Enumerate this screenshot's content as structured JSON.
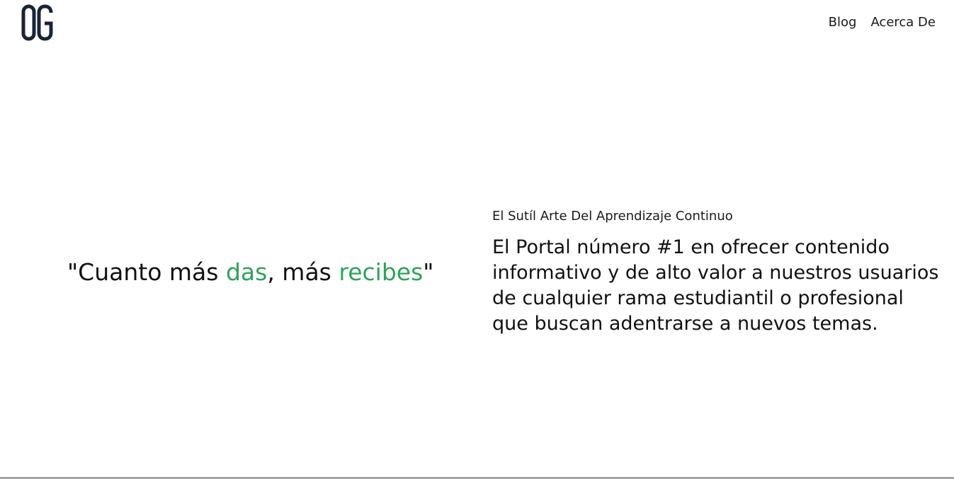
{
  "header": {
    "logo_text": "OG",
    "nav": [
      {
        "label": "Blog"
      },
      {
        "label": "Acerca De"
      }
    ]
  },
  "hero": {
    "quote": {
      "open": "\"Cuanto más ",
      "word1": "das",
      "middle": ", más ",
      "word2": "recibes",
      "close": "\""
    },
    "subtitle": "El Sutíl Arte Del Aprendizaje Continuo",
    "description": "El Portal número #1 en ofrecer contenido informativo y de alto valor a nuestros usuarios de cualquier rama estudiantil o profesional que buscan adentrarse a nuevos temas."
  },
  "colors": {
    "accent": "#2ea25a",
    "logo": "#1b2436",
    "text": "#111111"
  }
}
